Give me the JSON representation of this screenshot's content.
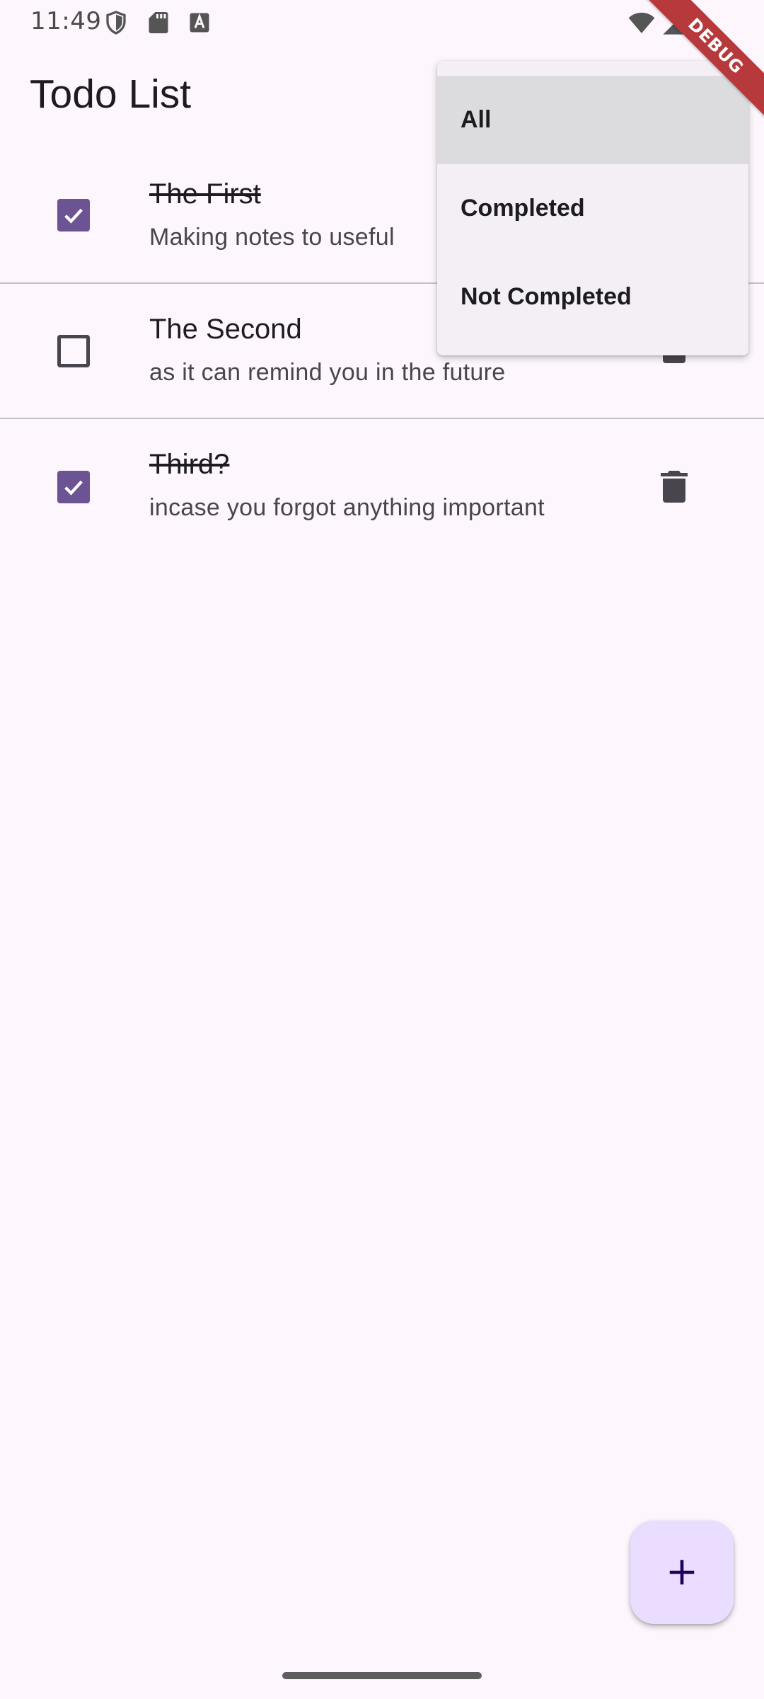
{
  "status_bar": {
    "time": "11:49",
    "icons": [
      "shield-icon",
      "sd-card-icon",
      "text-a-icon",
      "wifi-icon",
      "cell-signal-icon"
    ]
  },
  "debug_banner": {
    "label": "DEBUG",
    "color": "#b8393c"
  },
  "app_bar": {
    "title": "Todo List"
  },
  "todos": [
    {
      "title": "The First",
      "description": "Making notes to useful",
      "completed": true
    },
    {
      "title": "The Second",
      "description": "as it can remind you in the future",
      "completed": false
    },
    {
      "title": "Third?",
      "description": "incase you forgot anything important",
      "completed": true
    }
  ],
  "filter_menu": {
    "options": [
      "All",
      "Completed",
      "Not Completed"
    ],
    "selected": "All"
  },
  "fab": {
    "icon": "plus-icon"
  },
  "colors": {
    "background": "#fdf7fd",
    "accent": "#6b5394",
    "fab_background": "#eaddff",
    "menu_background": "#f3eff4",
    "menu_selected": "#dcdbde"
  }
}
